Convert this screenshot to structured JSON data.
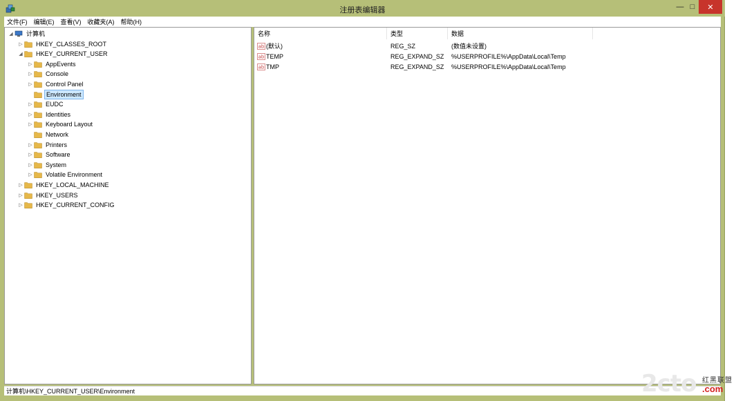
{
  "window": {
    "title": "注册表编辑器",
    "controls": {
      "minimize": "—",
      "maximize": "□",
      "close": "✕"
    }
  },
  "menu": [
    "文件(F)",
    "编辑(E)",
    "查看(V)",
    "收藏夹(A)",
    "帮助(H)"
  ],
  "tree": [
    {
      "label": "计算机",
      "depth": 0,
      "expanded": true,
      "icon": "computer-icon"
    },
    {
      "label": "HKEY_CLASSES_ROOT",
      "depth": 1,
      "expanded": false
    },
    {
      "label": "HKEY_CURRENT_USER",
      "depth": 1,
      "expanded": true
    },
    {
      "label": "AppEvents",
      "depth": 2,
      "expanded": false
    },
    {
      "label": "Console",
      "depth": 2,
      "expanded": false
    },
    {
      "label": "Control Panel",
      "depth": 2,
      "expanded": false
    },
    {
      "label": "Environment",
      "depth": 2,
      "selected": true,
      "leaf": true
    },
    {
      "label": "EUDC",
      "depth": 2,
      "expanded": false
    },
    {
      "label": "Identities",
      "depth": 2,
      "expanded": false
    },
    {
      "label": "Keyboard Layout",
      "depth": 2,
      "expanded": false
    },
    {
      "label": "Network",
      "depth": 2,
      "leaf": true
    },
    {
      "label": "Printers",
      "depth": 2,
      "expanded": false
    },
    {
      "label": "Software",
      "depth": 2,
      "expanded": false
    },
    {
      "label": "System",
      "depth": 2,
      "expanded": false
    },
    {
      "label": "Volatile Environment",
      "depth": 2,
      "expanded": false
    },
    {
      "label": "HKEY_LOCAL_MACHINE",
      "depth": 1,
      "expanded": false
    },
    {
      "label": "HKEY_USERS",
      "depth": 1,
      "expanded": false
    },
    {
      "label": "HKEY_CURRENT_CONFIG",
      "depth": 1,
      "expanded": false
    }
  ],
  "list": {
    "columns": [
      "名称",
      "类型",
      "数据"
    ],
    "rows": [
      {
        "name": "(默认)",
        "type": "REG_SZ",
        "data": "(数值未设置)"
      },
      {
        "name": "TEMP",
        "type": "REG_EXPAND_SZ",
        "data": "%USERPROFILE%\\AppData\\Local\\Temp"
      },
      {
        "name": "TMP",
        "type": "REG_EXPAND_SZ",
        "data": "%USERPROFILE%\\AppData\\Local\\Temp"
      }
    ]
  },
  "status": "计算机\\HKEY_CURRENT_USER\\Environment",
  "watermark": {
    "logo": "2cto",
    "cn": "红黑联盟",
    "domain": ".com"
  },
  "colors": {
    "titlebar": "#b6bf78",
    "close": "#c7342b",
    "folder": "#e6b84a",
    "selection": "#cce8ff",
    "watermark_red": "#d42020"
  }
}
